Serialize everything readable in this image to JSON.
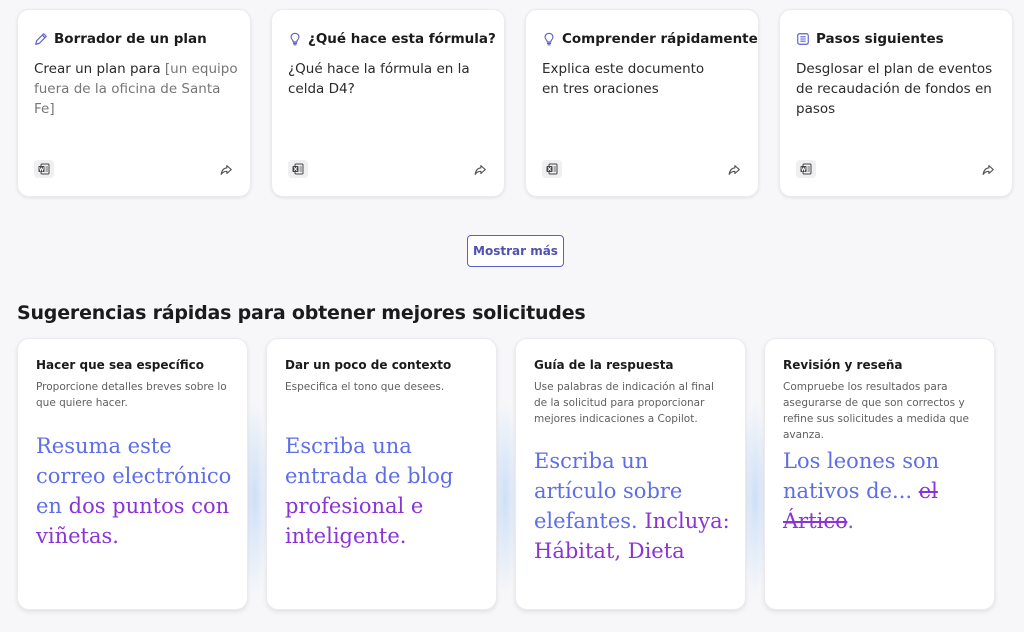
{
  "prompt_cards": [
    {
      "title": "Borrador de un plan",
      "icon": "pen-icon",
      "body_text": "Crear un plan para ",
      "body_placeholder": "[un equipo fuera de la oficina de Santa Fe]",
      "app_icon": "word-icon"
    },
    {
      "title": "¿Qué hace esta fórmula?",
      "icon": "lightbulb-icon",
      "body_text": "¿Qué hace la fórmula en la celda D4?",
      "body_placeholder": "",
      "app_icon": "excel-icon"
    },
    {
      "title": "Comprender rápidamente",
      "icon": "lightbulb-icon",
      "body_text": "Explica este documento en tres oraciones",
      "body_placeholder": "",
      "app_icon": "excel-icon"
    },
    {
      "title": "Pasos siguientes",
      "icon": "list-icon",
      "body_text": "Desglosar el plan de eventos de recaudación de fondos en pasos",
      "body_placeholder": "",
      "app_icon": "word-icon"
    }
  ],
  "show_more_label": "Mostrar más",
  "section_title": "Sugerencias rápidas para obtener mejores solicitudes",
  "tip_cards": [
    {
      "title": "Hacer que sea específico",
      "description": "Proporcione detalles breves sobre lo que quiere hacer.",
      "example_main": "Resuma este correo electrónico en ",
      "example_accent": "dos puntos con viñetas."
    },
    {
      "title": "Dar un poco de contexto",
      "description": "Especifica el tono que desees.",
      "example_main": "Escriba una entrada de blog ",
      "example_accent": "profesional e inteligente."
    },
    {
      "title": "Guía de la respuesta",
      "description": "Use palabras de indicación al final de la solicitud para proporcionar mejores indicaciones a Copilot.",
      "example_main": "Escriba un artículo sobre elefantes. ",
      "example_accent": "Incluya: Hábitat, Dieta"
    },
    {
      "title": "Revisión y reseña",
      "description": "Compruebe los resultados para asegurarse de que son correctos y refine sus solicitudes a medida que avanza.",
      "example_main": "Los leones son nativos de... ",
      "example_strike": "el Ártico",
      "example_tail": "."
    }
  ],
  "colors": {
    "accent_blue": "#5e6ee6",
    "accent_purple": "#8a34d6",
    "button_border": "#5b5fc7"
  }
}
